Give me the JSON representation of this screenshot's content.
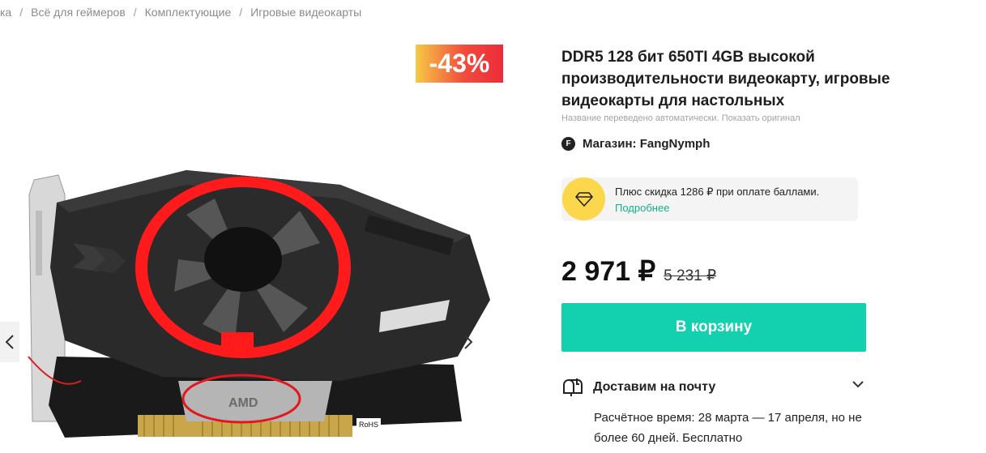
{
  "breadcrumbs": [
    "ка",
    "Всё для геймеров",
    "Комплектующие",
    "Игровые видеокарты"
  ],
  "gallery": {
    "discount": "-43%",
    "image_label": "AMD",
    "port_label": "RoHS"
  },
  "product": {
    "title": "DDR5 128 бит 650TI 4GB высокой производительности видеокарту, игровые видеокарты для настольных",
    "translated_note": "Название переведено автоматически. Показать оригинал",
    "shop_logo": "F",
    "shop": "Магазин: FangNymph"
  },
  "bonus": {
    "text": "Плюс скидка 1286 ₽ при оплате баллами.",
    "link": "Подробнее",
    "icon": "diamond-icon"
  },
  "price": {
    "current": "2 971 ₽",
    "old": "5 231 ₽"
  },
  "cart": {
    "label": "В корзину"
  },
  "delivery": {
    "title": "Доставим на почту",
    "details": "Расчётное время: 28 марта — 17 апреля, но не более 60 дней. Бесплатно"
  },
  "colors": {
    "accent": "#13d1ae",
    "link": "#14b08a",
    "bonus_bg": "#fcd74b",
    "badge_start": "#f7c945",
    "badge_end": "#ec2b3a"
  }
}
